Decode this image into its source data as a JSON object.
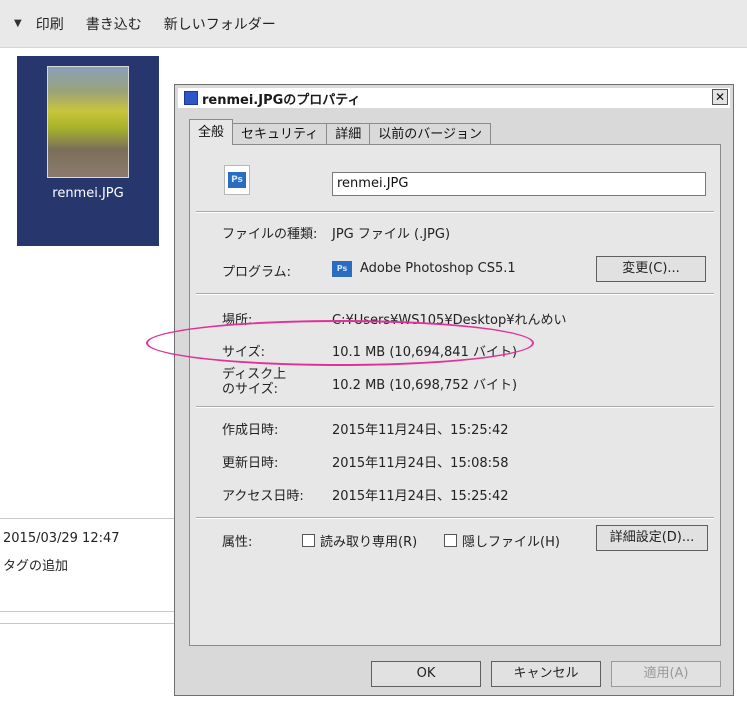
{
  "toolbar": {
    "items": [
      "印刷",
      "書き込む",
      "新しいフォルダー"
    ]
  },
  "file_pane": {
    "thumbnail_name": "renmei.JPG",
    "meta_date": "2015/03/29 12:47",
    "meta_tag": "タグの追加"
  },
  "dialog": {
    "title": "renmei.JPGのプロパティ",
    "close": "✕",
    "tabs": [
      "全般",
      "セキュリティ",
      "詳細",
      "以前のバージョン"
    ],
    "file_name": "renmei.JPG",
    "icon_text": "Ps",
    "rows": {
      "type_label": "ファイルの種類:",
      "type_value": "JPG ファイル (.JPG)",
      "program_label": "プログラム:",
      "program_value": "Adobe Photoshop CS5.1",
      "change_button": "変更(C)...",
      "location_label": "場所:",
      "location_value": "C:¥Users¥WS105¥Desktop¥れんめい",
      "size_label": "サイズ:",
      "size_value": "10.1 MB (10,694,841 バイト)",
      "disk_size_label_1": "ディスク上",
      "disk_size_label_2": "のサイズ:",
      "disk_size_value": "10.2 MB (10,698,752 バイト)",
      "created_label": "作成日時:",
      "created_value": "2015年11月24日、15:25:42",
      "modified_label": "更新日時:",
      "modified_value": "2015年11月24日、15:08:58",
      "accessed_label": "アクセス日時:",
      "accessed_value": "2015年11月24日、15:25:42",
      "attributes_label": "属性:",
      "readonly_label": "読み取り専用(R)",
      "hidden_label": "隠しファイル(H)",
      "advanced_button": "詳細設定(D)..."
    },
    "buttons": {
      "ok": "OK",
      "cancel": "キャンセル",
      "apply": "適用(A)"
    },
    "colors": {
      "highlight": "#e0319a",
      "selection": "#27376e"
    }
  }
}
